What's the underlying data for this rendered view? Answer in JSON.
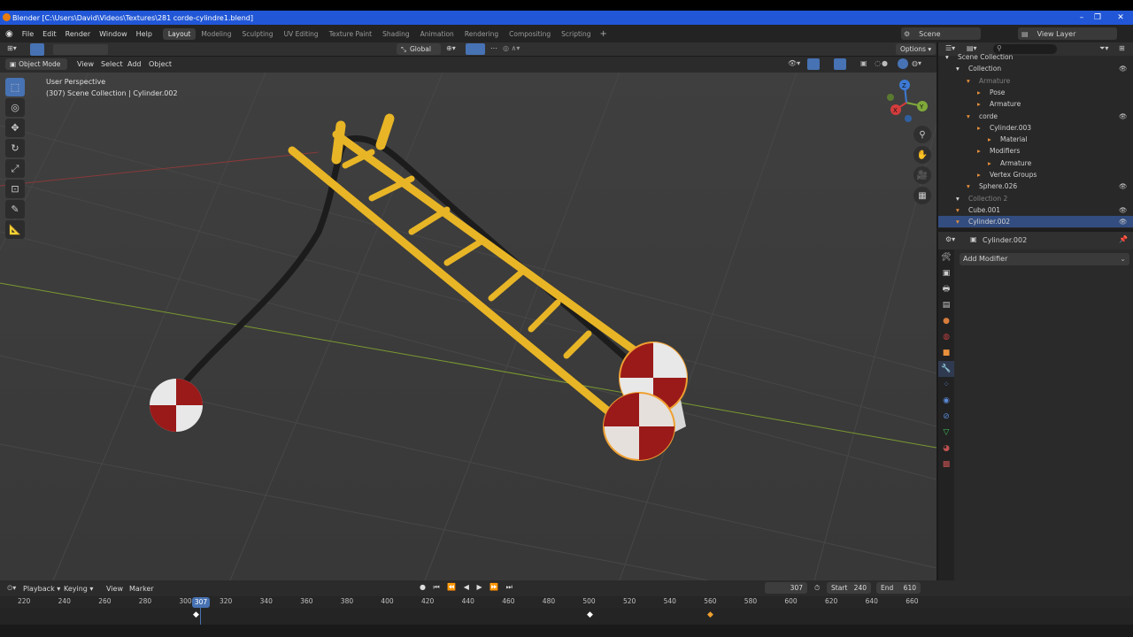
{
  "window": {
    "title": "Blender [C:\\Users\\David\\Videos\\Textures\\281 corde-cylindre1.blend]"
  },
  "menu": {
    "items": [
      "File",
      "Edit",
      "Render",
      "Window",
      "Help"
    ]
  },
  "workspaces": [
    "Layout",
    "Modeling",
    "Sculpting",
    "UV Editing",
    "Texture Paint",
    "Shading",
    "Animation",
    "Rendering",
    "Compositing",
    "Scripting"
  ],
  "active_workspace": "Layout",
  "scene": {
    "name": "Scene",
    "view_layer": "View Layer"
  },
  "header": {
    "transform_orientation": "Global",
    "options_label": "Options"
  },
  "viewport_header": {
    "mode": "Object Mode",
    "menus": [
      "View",
      "Select",
      "Add",
      "Object"
    ]
  },
  "viewport": {
    "perspective": "User Perspective",
    "collection_info": "(307) Scene Collection | Cylinder.002"
  },
  "gizmo": {
    "x": "X",
    "y": "Y",
    "z": "Z"
  },
  "outliner": {
    "rows": [
      {
        "label": "Scene Collection",
        "indent": 0
      },
      {
        "label": "Collection",
        "indent": 1
      },
      {
        "label": "Armature",
        "indent": 2,
        "dim": true
      },
      {
        "label": "Pose",
        "indent": 3
      },
      {
        "label": "Armature",
        "indent": 3
      },
      {
        "label": "corde",
        "indent": 2
      },
      {
        "label": "Cylinder.003",
        "indent": 3
      },
      {
        "label": "Material",
        "indent": 4
      },
      {
        "label": "Modifiers",
        "indent": 3
      },
      {
        "label": "Armature",
        "indent": 4
      },
      {
        "label": "Vertex Groups",
        "indent": 3
      },
      {
        "label": "Sphere.026",
        "indent": 2
      },
      {
        "label": "Collection 2",
        "indent": 1,
        "dim": true
      },
      {
        "label": "Cube.001",
        "indent": 1
      },
      {
        "label": "Cylinder.002",
        "indent": 1,
        "selected": true
      }
    ]
  },
  "properties": {
    "object_name": "Cylinder.002",
    "add_modifier": "Add Modifier"
  },
  "timeline": {
    "menus": [
      "Playback",
      "Keying",
      "View",
      "Marker"
    ],
    "current_frame": "307",
    "start_label": "Start",
    "start": "240",
    "end_label": "End",
    "end": "610",
    "ticks": [
      "220",
      "240",
      "260",
      "280",
      "300",
      "320",
      "340",
      "360",
      "380",
      "400",
      "420",
      "440",
      "460",
      "480",
      "500",
      "520",
      "540",
      "560",
      "580",
      "600",
      "620",
      "640",
      "660"
    ],
    "playhead_label": "307"
  },
  "colors": {
    "accent": "#4772b3",
    "selected_row": "#334d80",
    "ladder": "#e8b526",
    "title_bar": "#2157d6"
  }
}
